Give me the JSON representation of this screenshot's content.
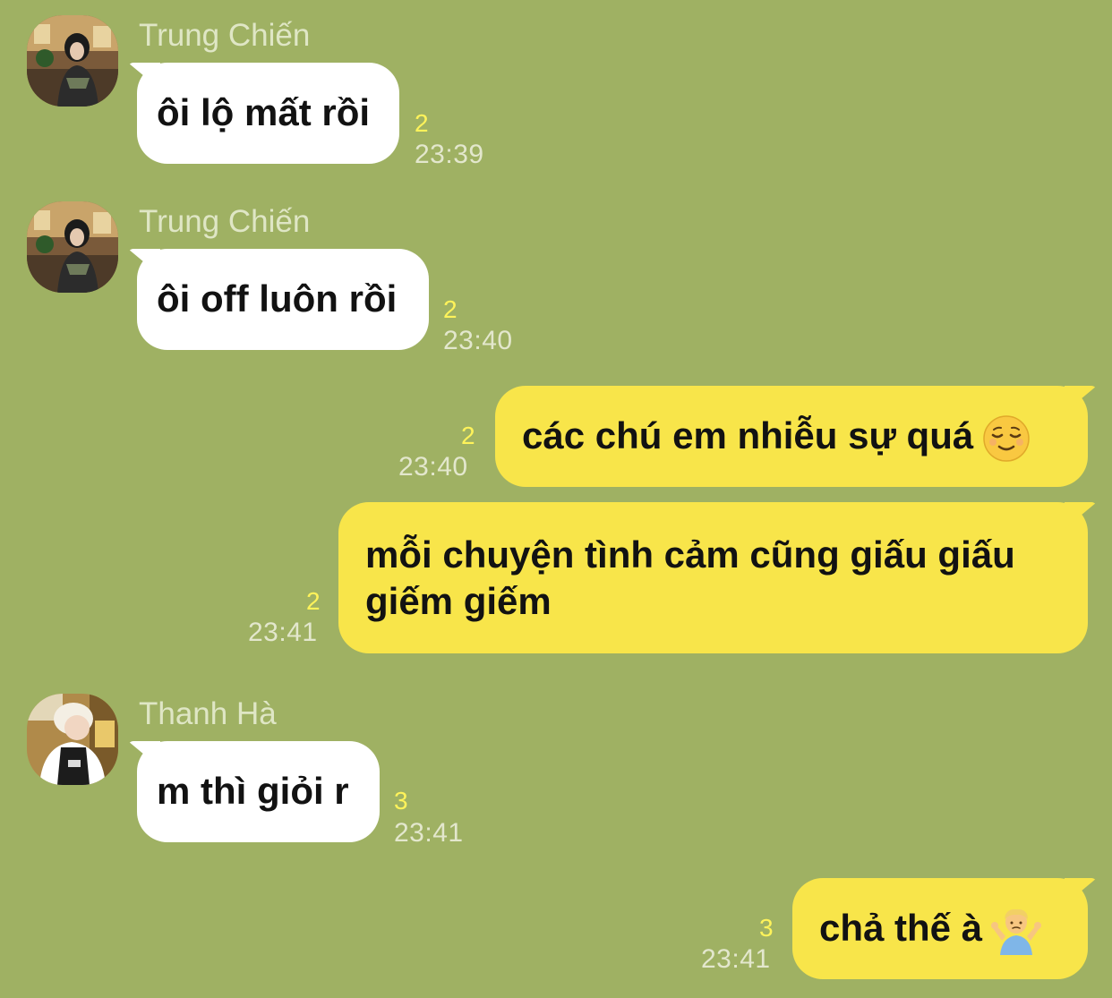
{
  "messages": [
    {
      "direction": "incoming",
      "sender": "Trung Chiến",
      "avatar_icon": "avatar-photo-trung-chien",
      "text": "ôi lộ mất rồi",
      "read_count": "2",
      "time": "23:39"
    },
    {
      "direction": "incoming",
      "sender": "Trung Chiến",
      "avatar_icon": "avatar-photo-trung-chien",
      "text": "ôi off luôn rồi",
      "read_count": "2",
      "time": "23:40"
    },
    {
      "direction": "outgoing",
      "text": "các chú em nhiễu sự quá",
      "emoji": "relieved-face-icon",
      "read_count": "2",
      "time": "23:40"
    },
    {
      "direction": "outgoing",
      "text": "mỗi chuyện tình cảm cũng giấu giấu giếm giếm",
      "read_count": "2",
      "time": "23:41"
    },
    {
      "direction": "incoming",
      "sender": "Thanh Hà",
      "avatar_icon": "avatar-photo-thanh-ha",
      "text": "m thì giỏi r",
      "read_count": "3",
      "time": "23:41"
    },
    {
      "direction": "outgoing",
      "text": "chả thế à",
      "emoji": "person-shrugging-icon",
      "read_count": "3",
      "time": "23:41"
    }
  ],
  "colors": {
    "background": "#9fb163",
    "incoming_bubble": "#ffffff",
    "outgoing_bubble": "#f8e54a",
    "read_count": "#fff35a",
    "timestamp": "#e3e7cd",
    "sender_name": "#dfe6c5"
  }
}
